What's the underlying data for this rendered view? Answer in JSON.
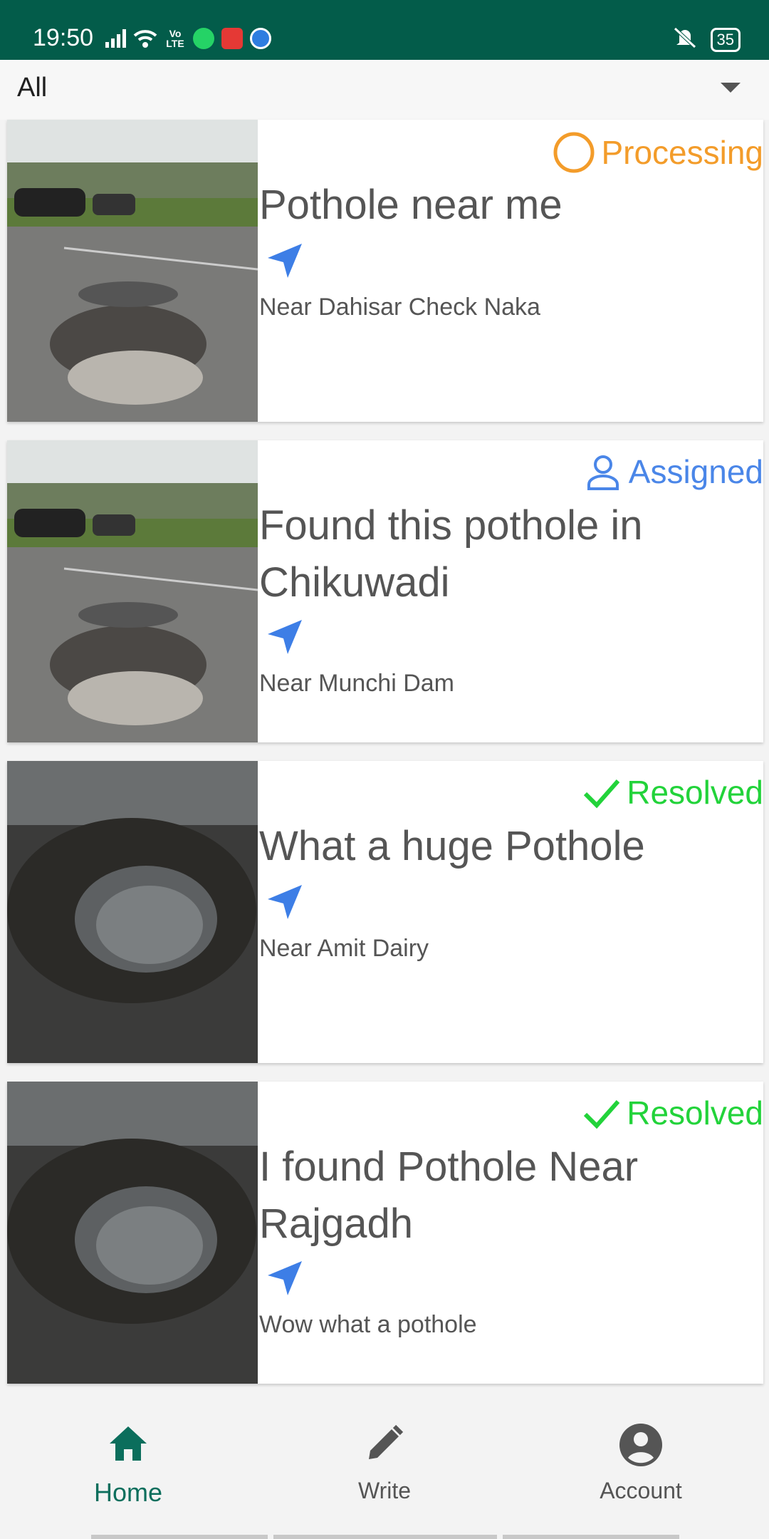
{
  "status_bar": {
    "time": "19:50",
    "battery": "35",
    "icons": [
      "signal-icon",
      "wifi-icon",
      "volte-icon",
      "whatsapp-icon",
      "youtube-icon",
      "vpn-icon",
      "mute-icon",
      "battery-icon"
    ],
    "volte_text": "Vo LTE"
  },
  "filter": {
    "selected": "All"
  },
  "cards": [
    {
      "status": "Processing",
      "status_icon": "circle-icon",
      "status_color": "#f39c2a",
      "title": "Pothole near me",
      "location": "Near Dahisar Check Naka"
    },
    {
      "status": "Assigned",
      "status_icon": "person-icon",
      "status_color": "#4a86e8",
      "title": "Found this pothole in Chikuwadi",
      "location": "Near Munchi Dam"
    },
    {
      "status": "Resolved",
      "status_icon": "check-icon",
      "status_color": "#22d33a",
      "title": "What a huge Pothole",
      "location": "Near Amit Dairy"
    },
    {
      "status": "Resolved",
      "status_icon": "check-icon",
      "status_color": "#22d33a",
      "title": "I found Pothole Near Rajgadh",
      "location": "Wow what a pothole"
    }
  ],
  "bottom_nav": [
    {
      "label": "Home",
      "icon": "home-icon",
      "active": true
    },
    {
      "label": "Write",
      "icon": "pencil-icon",
      "active": false
    },
    {
      "label": "Account",
      "icon": "account-icon",
      "active": false
    }
  ],
  "colors": {
    "status_bar": "#035c4a",
    "accent": "#0b6e5c",
    "nav_arrow": "#3d7ee6"
  }
}
